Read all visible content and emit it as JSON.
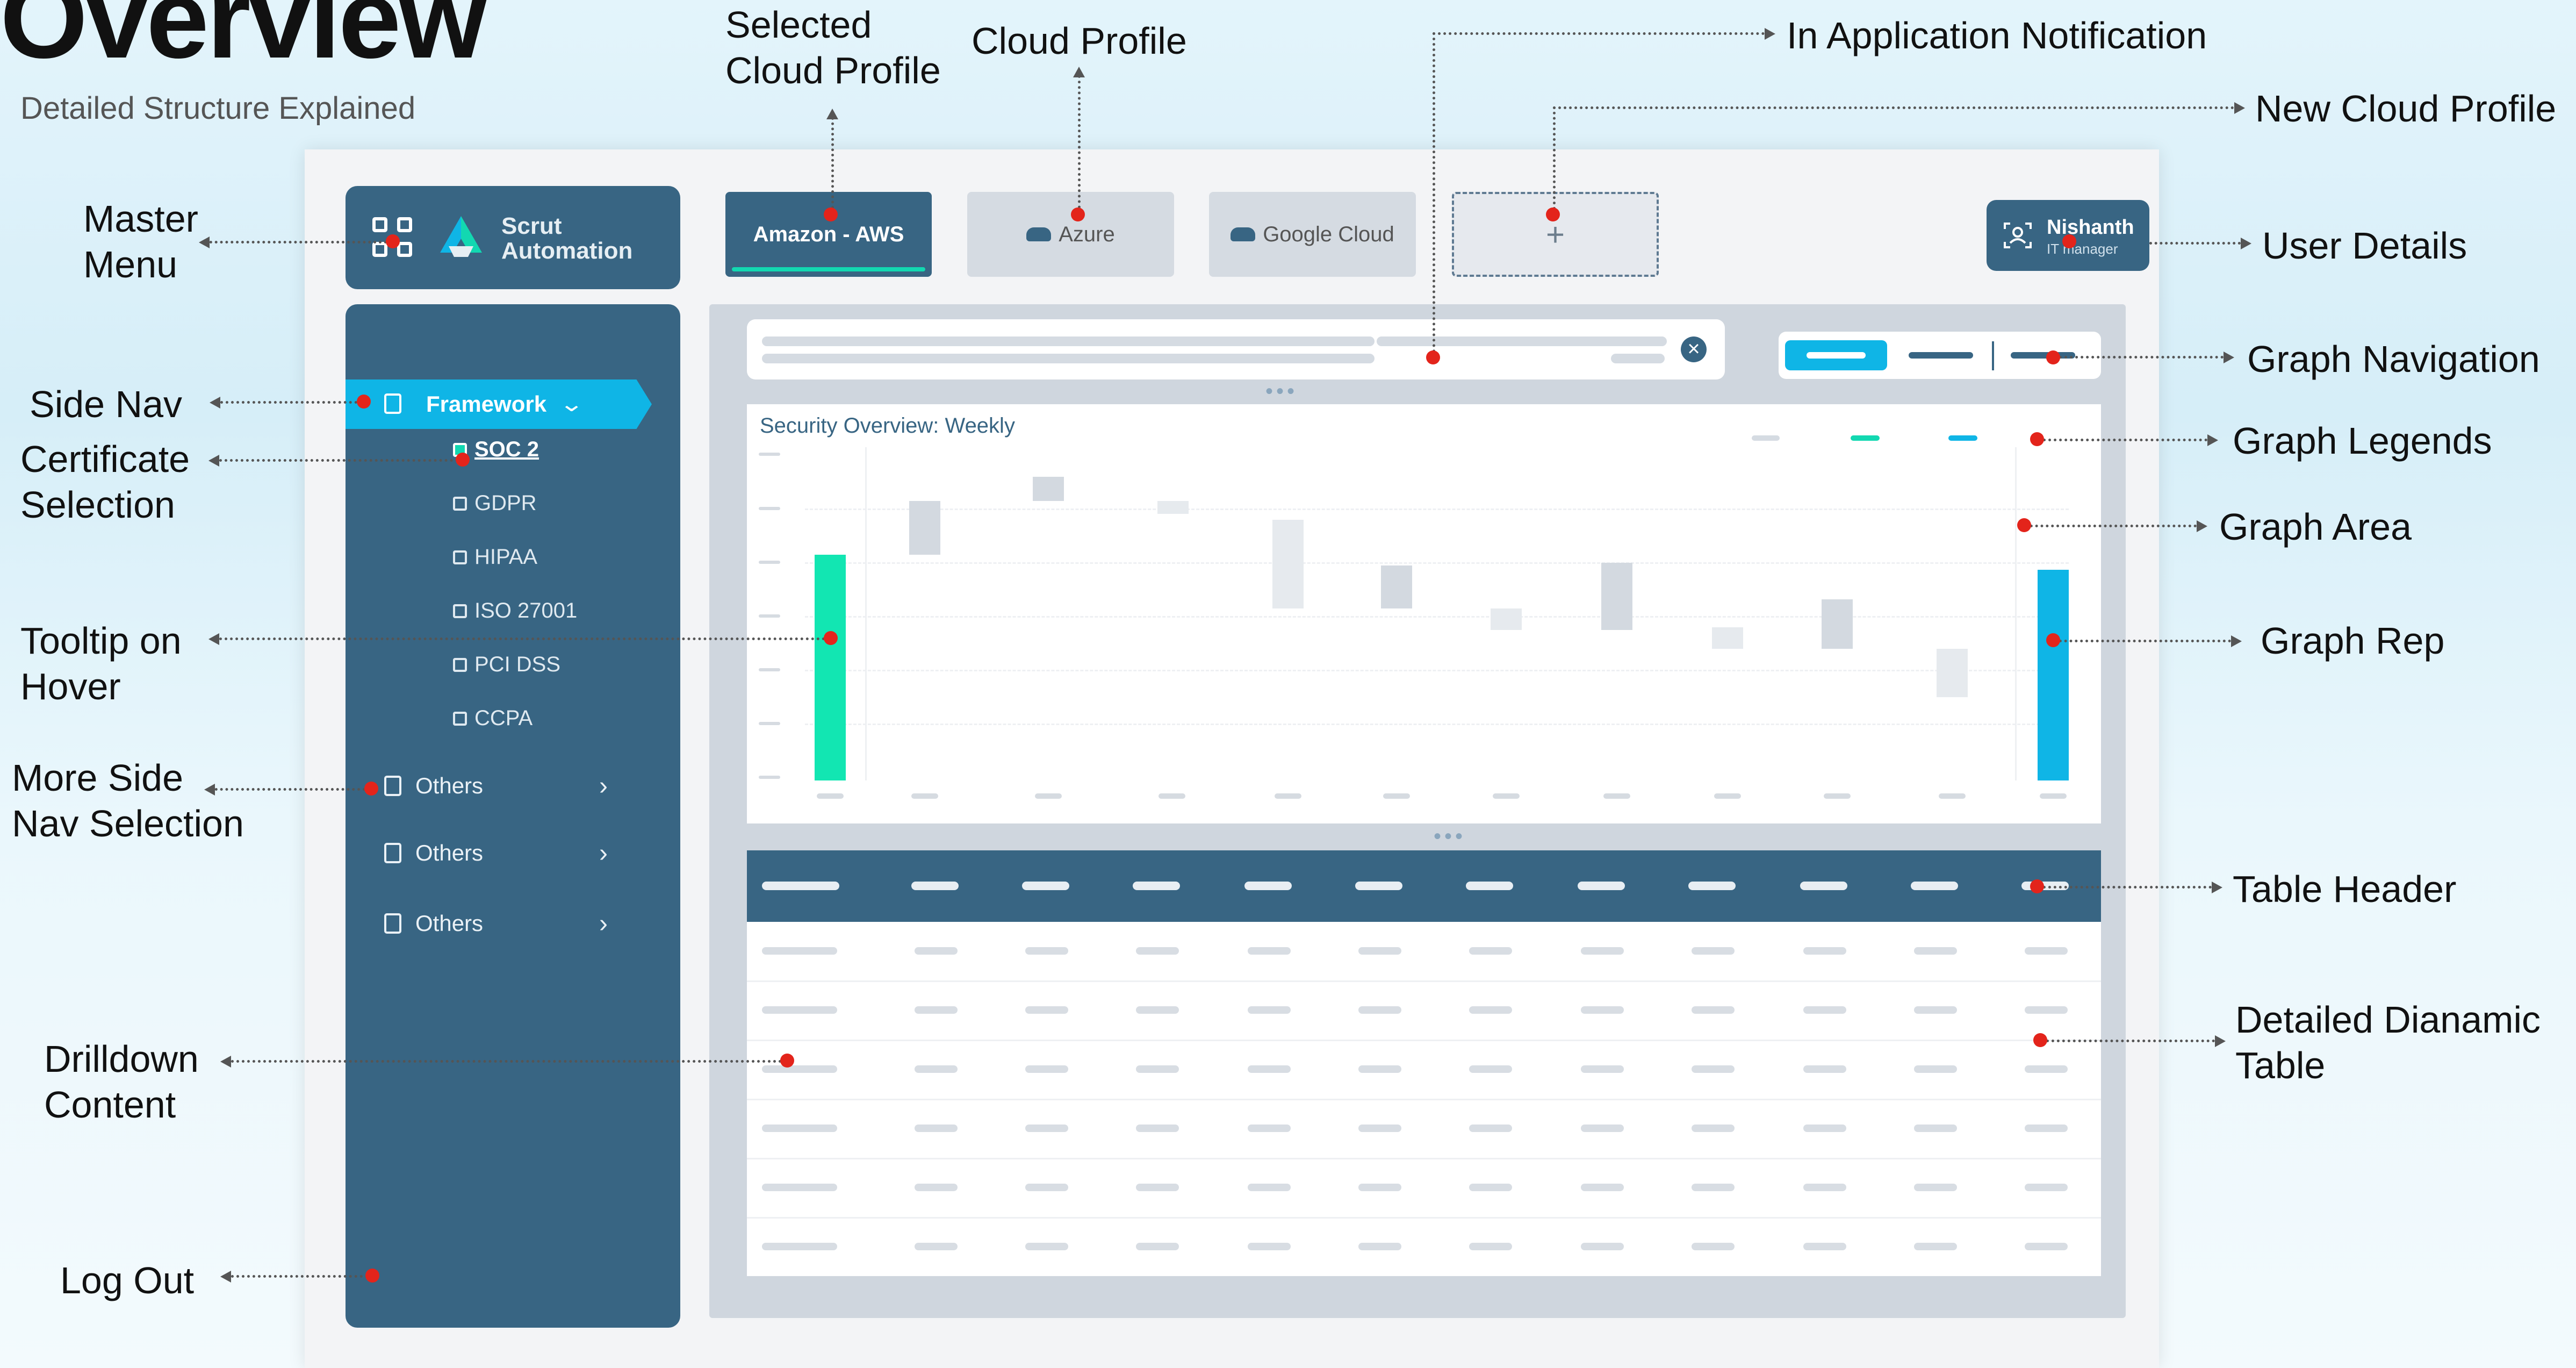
{
  "header": {
    "title": "Overview",
    "subtitle": "Detailed Structure Explained"
  },
  "brand": {
    "line1": "Scrut",
    "line2": "Automation"
  },
  "cloud_tabs": {
    "selected": "Amazon - AWS",
    "items": [
      "Amazon - AWS",
      "Azure",
      "Google Cloud"
    ],
    "add_symbol": "+"
  },
  "user": {
    "name": "Nishanth",
    "role": "IT manager"
  },
  "side_nav": {
    "active": "Framework",
    "frameworks": [
      "SOC 2",
      "GDPR",
      "HIPAA",
      "ISO 27001",
      "PCI DSS",
      "CCPA"
    ],
    "selected_framework": "SOC 2",
    "others": [
      "Others",
      "Others",
      "Others"
    ]
  },
  "graph": {
    "title": "Security Overview: Weekly"
  },
  "annotations": {
    "selected_cloud_profile": "Selected\nCloud Profile",
    "cloud_profile": "Cloud Profile",
    "in_app_notification": "In Application Notification",
    "new_cloud_profile": "New Cloud Profile",
    "master_menu": "Master\nMenu",
    "user_details": "User Details",
    "side_nav": "Side Nav",
    "graph_navigation": "Graph Navigation",
    "certificate_selection": "Certificate\nSelection",
    "graph_legends": "Graph Legends",
    "graph_area": "Graph Area",
    "tooltip_on_hover": "Tooltip on\nHover",
    "graph_rep": "Graph Rep",
    "more_side_nav": "More Side\nNav Selection",
    "table_header": "Table Header",
    "drilldown_content": "Drilldown\nContent",
    "detailed_table": "Detailed Dianamic\nTable",
    "log_out": "Log Out"
  },
  "colors": {
    "primary": "#386583",
    "accent_cyan": "#0fb5e6",
    "accent_green": "#12d8b1",
    "marker_red": "#e3241b",
    "panel_grey": "#cfd6de"
  },
  "icons": [
    "grid-menu-icon",
    "brand-logo-icon",
    "cloud-icon",
    "user-scan-icon",
    "clipboard-icon",
    "checkbox-icon",
    "chevron-down-icon",
    "chevron-right-icon",
    "close-icon"
  ]
}
